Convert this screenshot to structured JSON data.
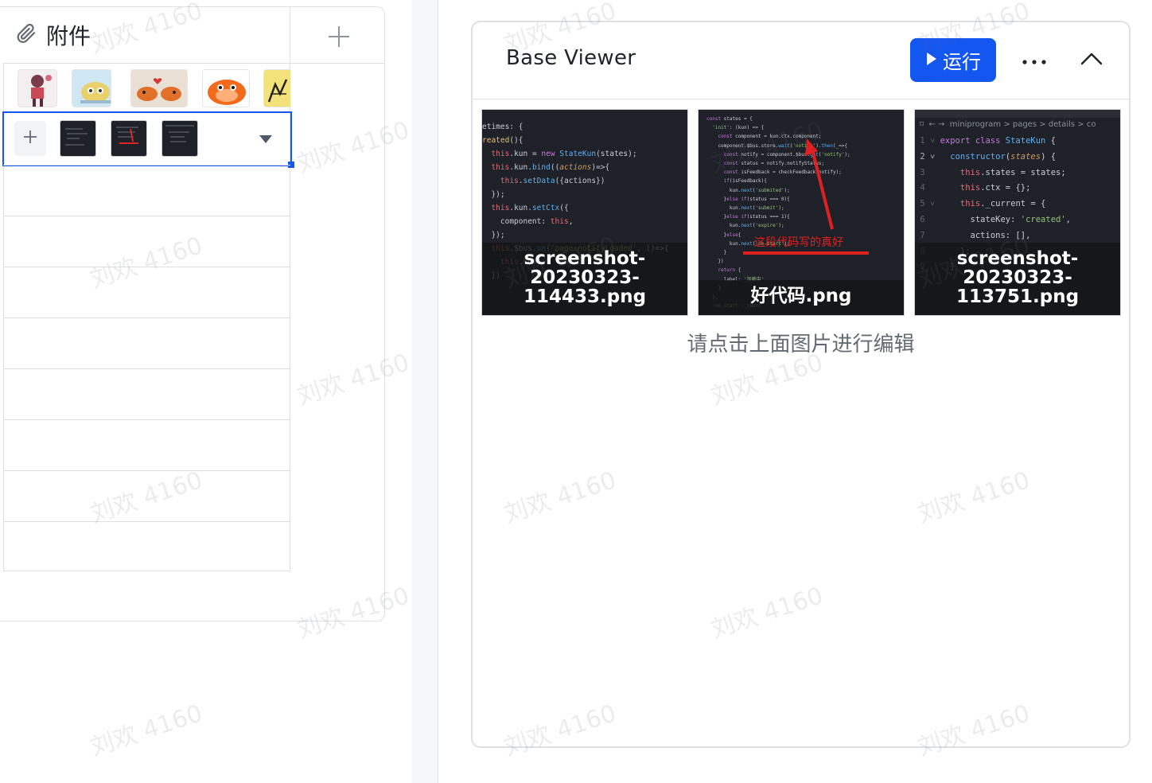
{
  "table": {
    "column_title": "附件",
    "icons": {
      "column_icon": "paperclip-icon",
      "add_column": "plus-icon",
      "cell_add": "plus-icon",
      "dropdown": "triangle-down-icon"
    }
  },
  "viewer": {
    "title": "Base Viewer",
    "run_label": "运行",
    "run_icon": "play-icon",
    "more_icon": "more-horizontal-icon",
    "collapse_icon": "chevron-up-icon",
    "accent_color": "#1456f0",
    "images": [
      {
        "caption": "screenshot-\n20230323-\n114433.png"
      },
      {
        "caption": "好代码.png",
        "annotation": "这段代码写的真好"
      },
      {
        "caption": "screenshot-\n20230323-\n113751.png",
        "breadcrumb": "miniprogram > pages > details > co"
      }
    ],
    "hint": "请点击上面图片进行编辑"
  },
  "watermark": "刘欢 4160"
}
